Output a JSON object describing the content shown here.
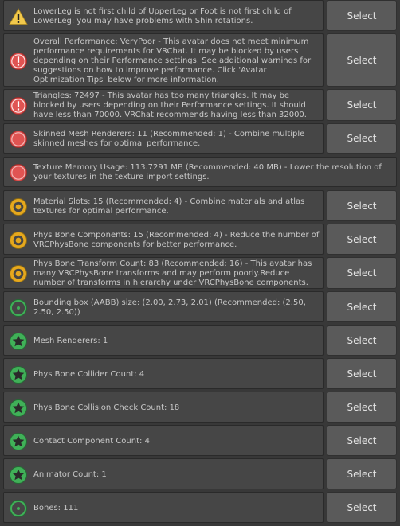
{
  "colors": {
    "warning": "#f2c94c",
    "error": "#e05452",
    "caution": "#e6a81d",
    "ok": "#40b058"
  },
  "select_label": "Select",
  "messages": [
    {
      "icon": "warning-triangle-icon",
      "text": "LowerLeg is not first child of UpperLeg or Foot is not first child of LowerLeg: you may have problems with Shin rotations.",
      "select": true
    },
    {
      "icon": "error-exclamation-icon",
      "text": "Overall Performance: VeryPoor - This avatar does not meet minimum performance requirements for VRChat. It may be blocked by users depending on their Performance settings. See additional warnings for suggestions on how to improve performance. Click 'Avatar Optimization Tips' below for more information.",
      "select": true
    },
    {
      "icon": "error-exclamation-icon",
      "text": "Triangles: 72497 - This avatar has too many triangles. It may be blocked by users depending on their Performance settings. It should have less than 70000. VRChat recommends having less than 32000.",
      "select": true
    },
    {
      "icon": "very-poor-circle-icon",
      "text": "Skinned Mesh Renderers: 11 (Recommended: 1) - Combine multiple skinned meshes for optimal performance.",
      "select": true
    },
    {
      "icon": "very-poor-circle-icon",
      "text": "Texture Memory Usage: 113.7291 MB (Recommended: 40 MB) - Lower the resolution of your textures in the texture import settings.",
      "select": false
    },
    {
      "icon": "medium-ring-icon",
      "text": "Material Slots: 15 (Recommended: 4) - Combine materials and atlas textures for optimal performance.",
      "select": true
    },
    {
      "icon": "medium-ring-icon",
      "text": "Phys Bone Components: 15 (Recommended: 4) - Reduce the number of VRCPhysBone components for better performance.",
      "select": true
    },
    {
      "icon": "medium-ring-icon",
      "text": "Phys Bone Transform Count: 83 (Recommended: 16) - This avatar has many VRCPhysBone transforms and may perform poorly.Reduce number of transforms in hierarchy under VRCPhysBone components.",
      "select": true
    },
    {
      "icon": "good-dot-icon",
      "text": "Bounding box (AABB) size: (2.00, 2.73, 2.01) (Recommended: (2.50, 2.50, 2.50))",
      "select": true
    },
    {
      "icon": "excellent-star-icon",
      "text": "Mesh Renderers: 1",
      "select": true
    },
    {
      "icon": "excellent-star-icon",
      "text": "Phys Bone Collider Count: 4",
      "select": true
    },
    {
      "icon": "excellent-star-icon",
      "text": "Phys Bone Collision Check Count: 18",
      "select": true
    },
    {
      "icon": "excellent-star-icon",
      "text": "Contact Component Count: 4",
      "select": true
    },
    {
      "icon": "excellent-star-icon",
      "text": "Animator Count: 1",
      "select": true
    },
    {
      "icon": "good-dot-icon",
      "text": "Bones: 111",
      "select": true
    }
  ]
}
